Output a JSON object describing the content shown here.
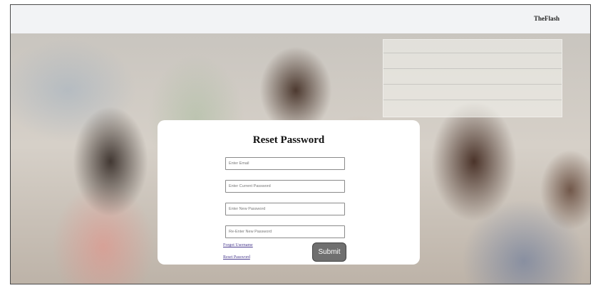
{
  "navbar": {
    "brand": "TheFlash"
  },
  "reset_form": {
    "title": "Reset Password",
    "fields": [
      {
        "name": "email",
        "placeholder": "Enter Email",
        "value": ""
      },
      {
        "name": "current_password",
        "placeholder": "Enter Current Password",
        "value": ""
      },
      {
        "name": "new_password",
        "placeholder": "Enter New Password",
        "value": ""
      },
      {
        "name": "reenter_new_password",
        "placeholder": "Re-Enter New Password",
        "value": ""
      }
    ],
    "links": {
      "forgot_username": "Forgot Username",
      "reset_password": "Reset Password"
    },
    "submit_label": "Submit"
  },
  "background": {
    "image_icon": "classroom-photo"
  },
  "colors": {
    "card": "#ffffff",
    "submit_button": "#6f6f6f",
    "link": "#4b3c8f",
    "navbar": "#f2f3f5"
  }
}
